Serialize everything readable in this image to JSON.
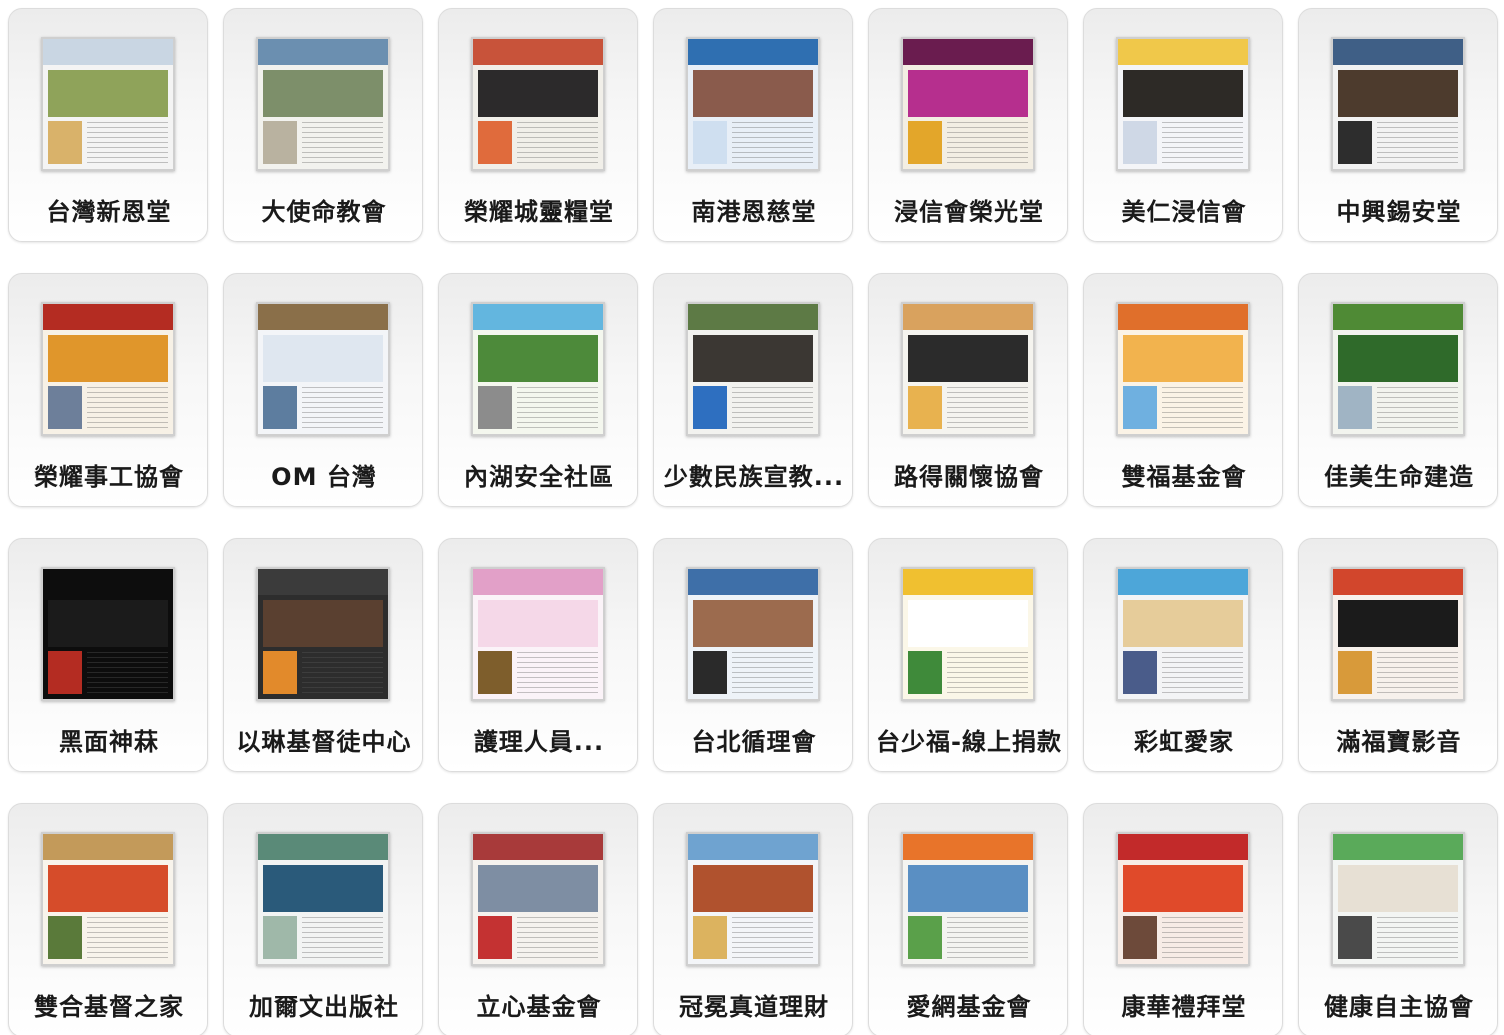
{
  "cards": [
    {
      "label": "台灣新恩堂",
      "thumb": {
        "bg": "#f4f4f4",
        "header": "#c9d6e3",
        "hero": "#8fa35a",
        "side": "#d9b26a"
      }
    },
    {
      "label": "大使命教會",
      "thumb": {
        "bg": "#f2f2ee",
        "header": "#6b8fb0",
        "hero": "#7d8f6a",
        "side": "#b9b2a0"
      }
    },
    {
      "label": "榮耀城靈糧堂",
      "thumb": {
        "bg": "#f1efe9",
        "header": "#c8533a",
        "hero": "#2c2a2b",
        "side": "#e06b3c"
      }
    },
    {
      "label": "南港恩慈堂",
      "thumb": {
        "bg": "#e8eff7",
        "header": "#2f6fb1",
        "hero": "#8a5b4c",
        "side": "#cfdff0"
      }
    },
    {
      "label": "浸信會榮光堂",
      "thumb": {
        "bg": "#f3eee3",
        "header": "#6a1c4f",
        "hero": "#b62f8e",
        "side": "#e3a62a"
      }
    },
    {
      "label": "美仁浸信會",
      "thumb": {
        "bg": "#f4f5f8",
        "header": "#f0c84a",
        "hero": "#2d2a26",
        "side": "#cfd8e6"
      }
    },
    {
      "label": "中興錫安堂",
      "thumb": {
        "bg": "#f2f2f2",
        "header": "#3f5f86",
        "hero": "#4d3b2d",
        "side": "#2d2d2d"
      }
    },
    {
      "label": "榮耀事工協會",
      "thumb": {
        "bg": "#f7f1e6",
        "header": "#b42c22",
        "hero": "#e0962b",
        "side": "#6d7f9a"
      }
    },
    {
      "label": "OM 台灣",
      "thumb": {
        "bg": "#f3f5f8",
        "header": "#8a6f49",
        "hero": "#dfe7f0",
        "side": "#5d7d9f"
      }
    },
    {
      "label": "內湖安全社區",
      "thumb": {
        "bg": "#f4f7ee",
        "header": "#63b6df",
        "hero": "#4d8a3a",
        "side": "#8c8c8c"
      }
    },
    {
      "label": "少數民族宣教...",
      "thumb": {
        "bg": "#f2f2ef",
        "header": "#5d7a45",
        "hero": "#3b3733",
        "side": "#2e6fc0"
      }
    },
    {
      "label": "路得關懷協會",
      "thumb": {
        "bg": "#f5f4ef",
        "header": "#d9a25e",
        "hero": "#2b2b2b",
        "side": "#e8b24f"
      }
    },
    {
      "label": "雙福基金會",
      "thumb": {
        "bg": "#fbf3e6",
        "header": "#e06f2b",
        "hero": "#f2b34e",
        "side": "#6fb0e0"
      }
    },
    {
      "label": "佳美生命建造",
      "thumb": {
        "bg": "#f2f4ee",
        "header": "#4f8a35",
        "hero": "#2f6a2a",
        "side": "#a0b4c4"
      }
    },
    {
      "label": "黑面神菻",
      "thumb": {
        "bg": "#0d0d0d",
        "header": "#0d0d0d",
        "hero": "#1b1b1b",
        "side": "#b42c22"
      }
    },
    {
      "label": "以琳基督徒中心",
      "thumb": {
        "bg": "#2d2d2d",
        "header": "#3b3b3b",
        "hero": "#5a4030",
        "side": "#e28a2b"
      }
    },
    {
      "label": "護理人員...",
      "thumb": {
        "bg": "#fbf3f8",
        "header": "#e2a0c8",
        "hero": "#f5d8e8",
        "side": "#7e5e2c"
      }
    },
    {
      "label": "台北循理會",
      "thumb": {
        "bg": "#eef3f8",
        "header": "#3e6fa8",
        "hero": "#9c6b4e",
        "side": "#2a2a2a"
      }
    },
    {
      "label": "台少福-線上捐款",
      "thumb": {
        "bg": "#fbf7e8",
        "header": "#f0c030",
        "hero": "#ffffff",
        "side": "#3f8a3a"
      }
    },
    {
      "label": "彩虹愛家",
      "thumb": {
        "bg": "#f3f4f6",
        "header": "#4da6d9",
        "hero": "#e6cc9a",
        "side": "#4a5c8a"
      }
    },
    {
      "label": "滿福寶影音",
      "thumb": {
        "bg": "#f7f1ec",
        "header": "#d2462c",
        "hero": "#1b1b1b",
        "side": "#d89a3a"
      }
    },
    {
      "label": "雙合基督之家",
      "thumb": {
        "bg": "#f8f4ec",
        "header": "#c39a5a",
        "hero": "#d64c2a",
        "side": "#5a7a3a"
      }
    },
    {
      "label": "加爾文出版社",
      "thumb": {
        "bg": "#f2f4f3",
        "header": "#5a8a78",
        "hero": "#2a5a7a",
        "side": "#9fb8a9"
      }
    },
    {
      "label": "立心基金會",
      "thumb": {
        "bg": "#f5f2ee",
        "header": "#a83a3a",
        "hero": "#7e8ea3",
        "side": "#c43232"
      }
    },
    {
      "label": "冠冕真道理財",
      "thumb": {
        "bg": "#f3f5f8",
        "header": "#6fa3d0",
        "hero": "#b0522e",
        "side": "#dcb35f"
      }
    },
    {
      "label": "愛網基金會",
      "thumb": {
        "bg": "#f4f4f1",
        "header": "#e8742a",
        "hero": "#5a8fc3",
        "side": "#5aa04a"
      }
    },
    {
      "label": "康華禮拜堂",
      "thumb": {
        "bg": "#f7ece6",
        "header": "#c22a2a",
        "hero": "#e04a2a",
        "side": "#6d4a3a"
      }
    },
    {
      "label": "健康自主協會",
      "thumb": {
        "bg": "#f3f5f3",
        "header": "#5aaa5a",
        "hero": "#e7e0d4",
        "side": "#4a4a4a"
      }
    }
  ]
}
